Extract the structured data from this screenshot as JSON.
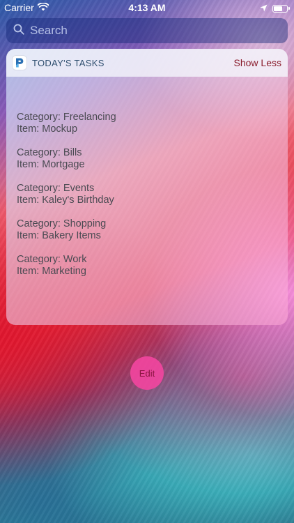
{
  "status_bar": {
    "carrier": "Carrier",
    "time": "4:13 AM",
    "battery_level": 0.6,
    "icons": [
      "wifi-icon",
      "location-arrow-icon",
      "battery-icon"
    ]
  },
  "search": {
    "placeholder": "Search",
    "value": ""
  },
  "widget": {
    "app_icon": "app-icon",
    "title": "TODAY'S TASKS",
    "toggle_label": "Show Less",
    "tasks": [
      {
        "category": "Category: Freelancing",
        "item": "Item: Mockup"
      },
      {
        "category": "Category: Bills",
        "item": "Item: Mortgage"
      },
      {
        "category": "Category: Events",
        "item": "Item: Kaley's Birthday"
      },
      {
        "category": "Category: Shopping",
        "item": "Item: Bakery Items"
      },
      {
        "category": "Category: Work",
        "item": "Item: Marketing"
      }
    ]
  },
  "edit_button": {
    "label": "Edit"
  },
  "colors": {
    "accent_edit": "#f546a0",
    "show_less": "#8a1c2c",
    "title": "#2f4f6f"
  }
}
